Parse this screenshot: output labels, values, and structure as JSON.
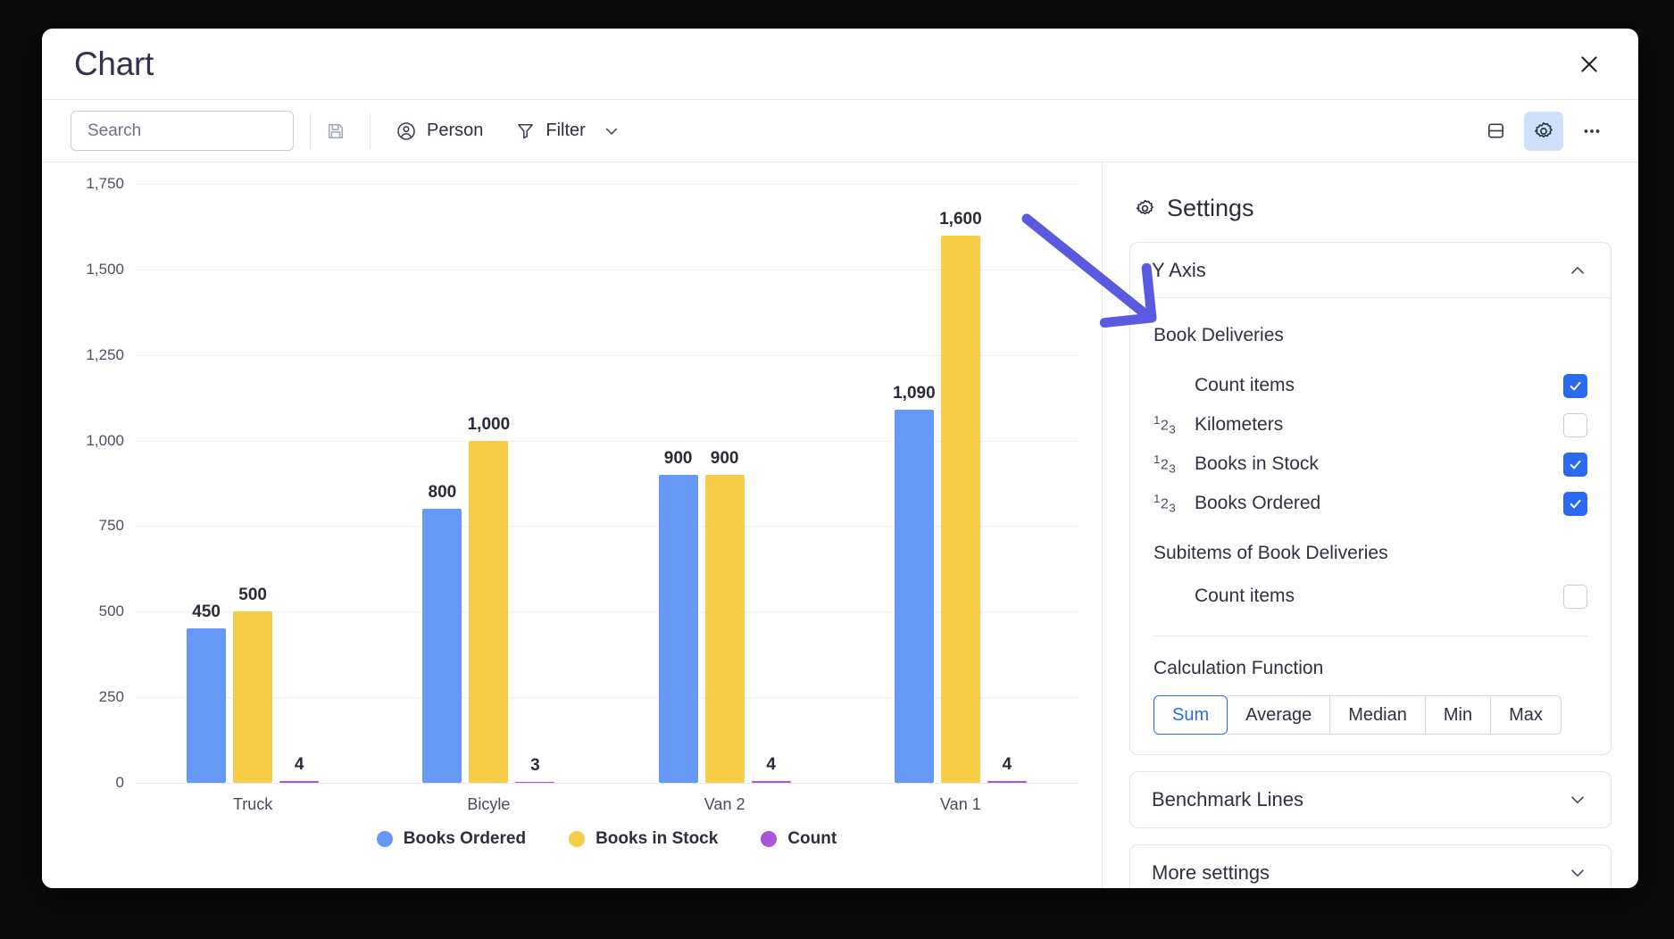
{
  "window": {
    "title": "Chart",
    "close_icon": "close-icon"
  },
  "toolbar": {
    "search_placeholder": "Search",
    "search_value": "",
    "search_icon": "search-icon",
    "save_icon": "save-disk-icon",
    "person_label": "Person",
    "person_icon": "person-icon",
    "filter_label": "Filter",
    "filter_icon": "funnel-icon",
    "filter_chevron_icon": "chevron-down-icon",
    "layout_icon": "split-layout-icon",
    "settings_icon": "gear-icon",
    "more_icon": "ellipsis-icon"
  },
  "chart_data": {
    "type": "bar",
    "title": "",
    "xlabel": "",
    "ylabel": "",
    "categories": [
      "Truck",
      "Bicyle",
      "Van 2",
      "Van 1"
    ],
    "series": [
      {
        "name": "Books Ordered",
        "color": "#6699F5",
        "values": [
          450,
          800,
          900,
          1090
        ],
        "labels": [
          "450",
          "800",
          "900",
          "1,090"
        ]
      },
      {
        "name": "Books in Stock",
        "color": "#F5CD47",
        "values": [
          500,
          1000,
          900,
          1600
        ],
        "labels": [
          "500",
          "1,000",
          "900",
          "1,600"
        ]
      },
      {
        "name": "Count",
        "color": "#A855DC",
        "values": [
          4,
          3,
          4,
          4
        ],
        "labels": [
          "4",
          "3",
          "4",
          "4"
        ]
      }
    ],
    "ylim": [
      0,
      1750
    ],
    "yticks": [
      0,
      250,
      500,
      750,
      1000,
      1250,
      1500,
      1750
    ],
    "ytick_labels": [
      "0",
      "250",
      "500",
      "750",
      "1,000",
      "1,250",
      "1,500",
      "1,750"
    ],
    "grid": true,
    "legend_position": "bottom"
  },
  "settings": {
    "heading": "Settings",
    "gear_icon": "gear-icon",
    "y_axis": {
      "title": "Y Axis",
      "chevron_icon": "chevron-up-icon",
      "group_label": "Book Deliveries",
      "options": [
        {
          "name": "Count items",
          "num_icon": "",
          "checked": true
        },
        {
          "name": "Kilometers",
          "num_icon": "123",
          "checked": false
        },
        {
          "name": "Books in Stock",
          "num_icon": "123",
          "checked": true
        },
        {
          "name": "Books Ordered",
          "num_icon": "123",
          "checked": true
        }
      ],
      "subitems_label": "Subitems of Book Deliveries",
      "subitem_options": [
        {
          "name": "Count items",
          "num_icon": "",
          "checked": false
        }
      ],
      "calc_label": "Calculation Function",
      "calc_options": [
        "Sum",
        "Average",
        "Median",
        "Min",
        "Max"
      ],
      "calc_selected": "Sum"
    },
    "benchmark": {
      "title": "Benchmark Lines",
      "chevron_icon": "chevron-down-icon"
    },
    "more": {
      "title": "More settings",
      "chevron_icon": "chevron-down-icon"
    }
  },
  "annotation": {
    "arrow_color": "#5A5AE0",
    "arrow_name": "pointer-arrow"
  },
  "colors": {
    "accent_blue": "#2a6af0",
    "series_blue": "#6699F5",
    "series_yellow": "#F5CD47",
    "series_purple": "#A855DC"
  }
}
